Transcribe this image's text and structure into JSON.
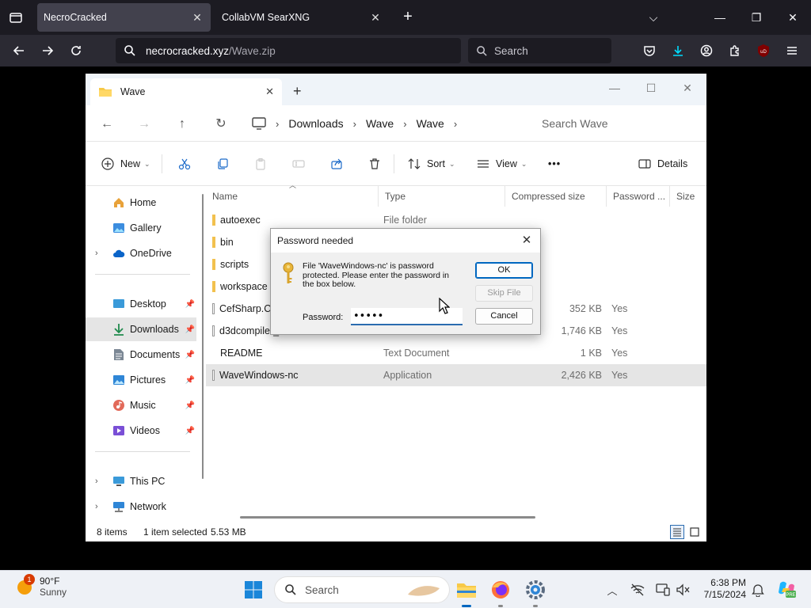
{
  "browser": {
    "tabs": [
      {
        "title": "NecroCracked",
        "active": true
      },
      {
        "title": "CollabVM SearXNG",
        "active": false
      }
    ],
    "url": {
      "host": "necrocracked.xyz",
      "path": "/Wave.zip"
    },
    "search_placeholder": "Search",
    "profile_badge": "uD"
  },
  "explorer": {
    "tab_title": "Wave",
    "breadcrumbs": [
      "Downloads",
      "Wave",
      "Wave"
    ],
    "search_placeholder": "Search Wave",
    "commands": {
      "new": "New",
      "sort": "Sort",
      "view": "View",
      "more": "•••",
      "details": "Details"
    },
    "sidebar": [
      {
        "label": "Home",
        "icon": "home-icon"
      },
      {
        "label": "Gallery",
        "icon": "gallery-icon"
      },
      {
        "label": "OneDrive",
        "icon": "cloud-icon"
      },
      {
        "label": "Desktop",
        "icon": "desktop-icon"
      },
      {
        "label": "Downloads",
        "icon": "download-icon"
      },
      {
        "label": "Documents",
        "icon": "document-icon"
      },
      {
        "label": "Pictures",
        "icon": "picture-icon"
      },
      {
        "label": "Music",
        "icon": "music-icon"
      },
      {
        "label": "Videos",
        "icon": "video-icon"
      },
      {
        "label": "This PC",
        "icon": "pc-icon"
      },
      {
        "label": "Network",
        "icon": "network-icon"
      }
    ],
    "columns": [
      "Name",
      "Type",
      "Compressed size",
      "Password ...",
      "Size"
    ],
    "files": [
      {
        "name": "autoexec",
        "type": "File folder",
        "csize": "",
        "pwd": "",
        "kind": "folder"
      },
      {
        "name": "bin",
        "type": "",
        "csize": "",
        "pwd": "",
        "kind": "folder"
      },
      {
        "name": "scripts",
        "type": "",
        "csize": "",
        "pwd": "",
        "kind": "folder"
      },
      {
        "name": "workspace",
        "type": "",
        "csize": "",
        "pwd": "",
        "kind": "folder"
      },
      {
        "name": "CefSharp.Co",
        "type": "",
        "csize": "352 KB",
        "pwd": "Yes",
        "kind": "file"
      },
      {
        "name": "d3dcompiler_",
        "type": "",
        "csize": "1,746 KB",
        "pwd": "Yes",
        "kind": "file"
      },
      {
        "name": "README",
        "type": "Text Document",
        "csize": "1 KB",
        "pwd": "Yes",
        "kind": "file"
      },
      {
        "name": "WaveWindows-nc",
        "type": "Application",
        "csize": "2,426 KB",
        "pwd": "Yes",
        "kind": "file"
      }
    ],
    "status": {
      "items": "8 items",
      "selected": "1 item selected",
      "size": "5.53 MB"
    }
  },
  "dialog": {
    "title": "Password needed",
    "message": "File 'WaveWindows-nc' is password protected.  Please enter the password in the box below.",
    "password_label": "Password:",
    "password_value": "•••••",
    "ok": "OK",
    "skip": "Skip File",
    "cancel": "Cancel"
  },
  "taskbar": {
    "weather_temp": "90°F",
    "weather_cond": "Sunny",
    "weather_badge": "1",
    "search_placeholder": "Search",
    "time": "6:38 PM",
    "date": "7/15/2024"
  },
  "colors": {
    "accent": "#0067c0",
    "browser_bg": "#1c1b22",
    "selection": "#e5e5e5"
  }
}
